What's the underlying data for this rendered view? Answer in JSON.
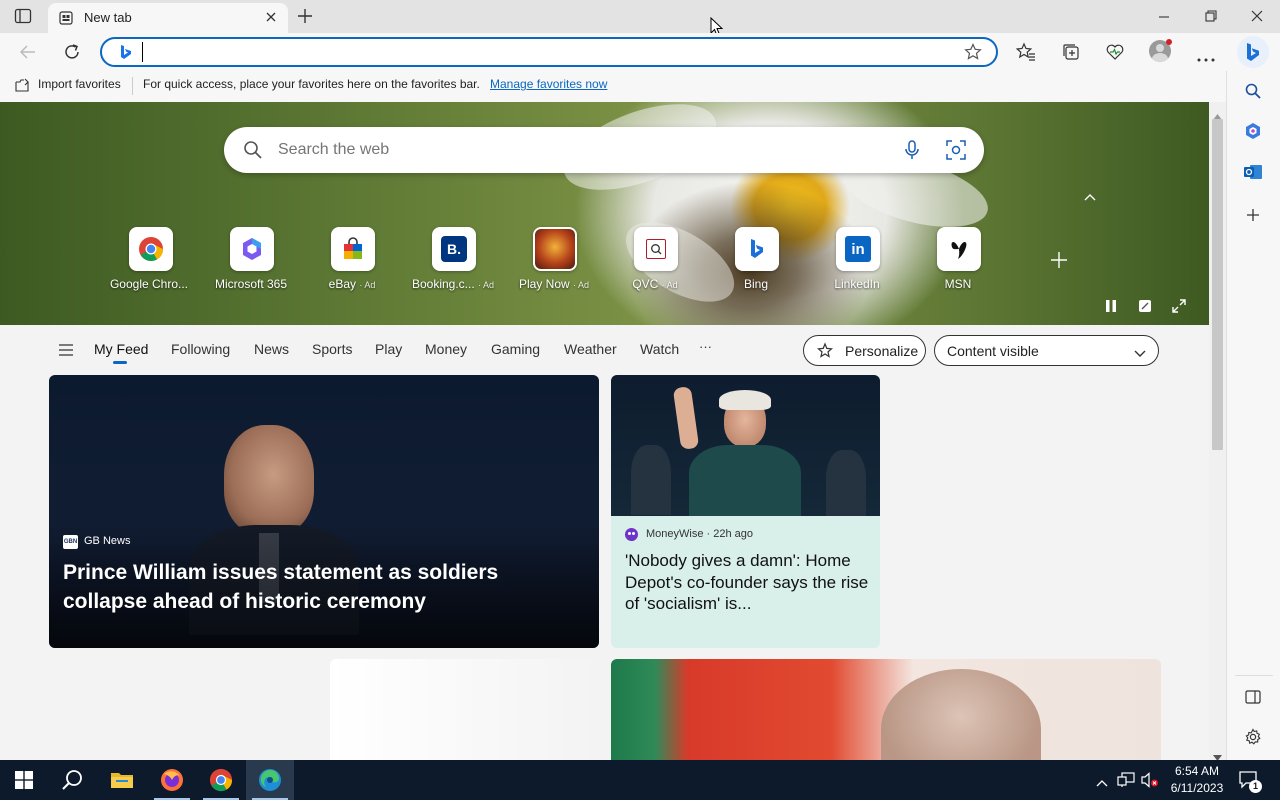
{
  "tab": {
    "title": "New tab"
  },
  "address_bar": {
    "value": ""
  },
  "favorites_bar": {
    "import_label": "Import favorites",
    "message": "For quick access, place your favorites here on the favorites bar.",
    "manage_link": "Manage favorites now"
  },
  "search": {
    "placeholder": "Search the web"
  },
  "quick_links": [
    {
      "label": "Google Chro...",
      "ad": ""
    },
    {
      "label": "Microsoft 365",
      "ad": ""
    },
    {
      "label": "eBay",
      "ad": "· Ad"
    },
    {
      "label": "Booking.c...",
      "ad": "· Ad"
    },
    {
      "label": "Play Now",
      "ad": "· Ad"
    },
    {
      "label": "QVC",
      "ad": "· Ad"
    },
    {
      "label": "Bing",
      "ad": ""
    },
    {
      "label": "LinkedIn",
      "ad": ""
    },
    {
      "label": "MSN",
      "ad": ""
    }
  ],
  "feed_nav": {
    "items": [
      "My Feed",
      "Following",
      "News",
      "Sports",
      "Play",
      "Money",
      "Gaming",
      "Weather",
      "Watch",
      "···"
    ],
    "personalize": "Personalize",
    "content_visible": "Content visible"
  },
  "cards": [
    {
      "source": "GB News",
      "source_logo": "GBN",
      "headline": "Prince William issues statement as soldiers collapse ahead of historic ceremony"
    },
    {
      "source": "MoneyWise",
      "time": "· 22h ago",
      "headline": "'Nobody gives a damn': Home Depot's co-founder says the rise of 'socialism' is..."
    }
  ],
  "taskbar": {
    "time": "6:54 AM",
    "date": "6/11/2023",
    "notification_count": "1"
  },
  "colors": {
    "accent": "#0b67c2",
    "taskbar": "#0d1a2b"
  }
}
